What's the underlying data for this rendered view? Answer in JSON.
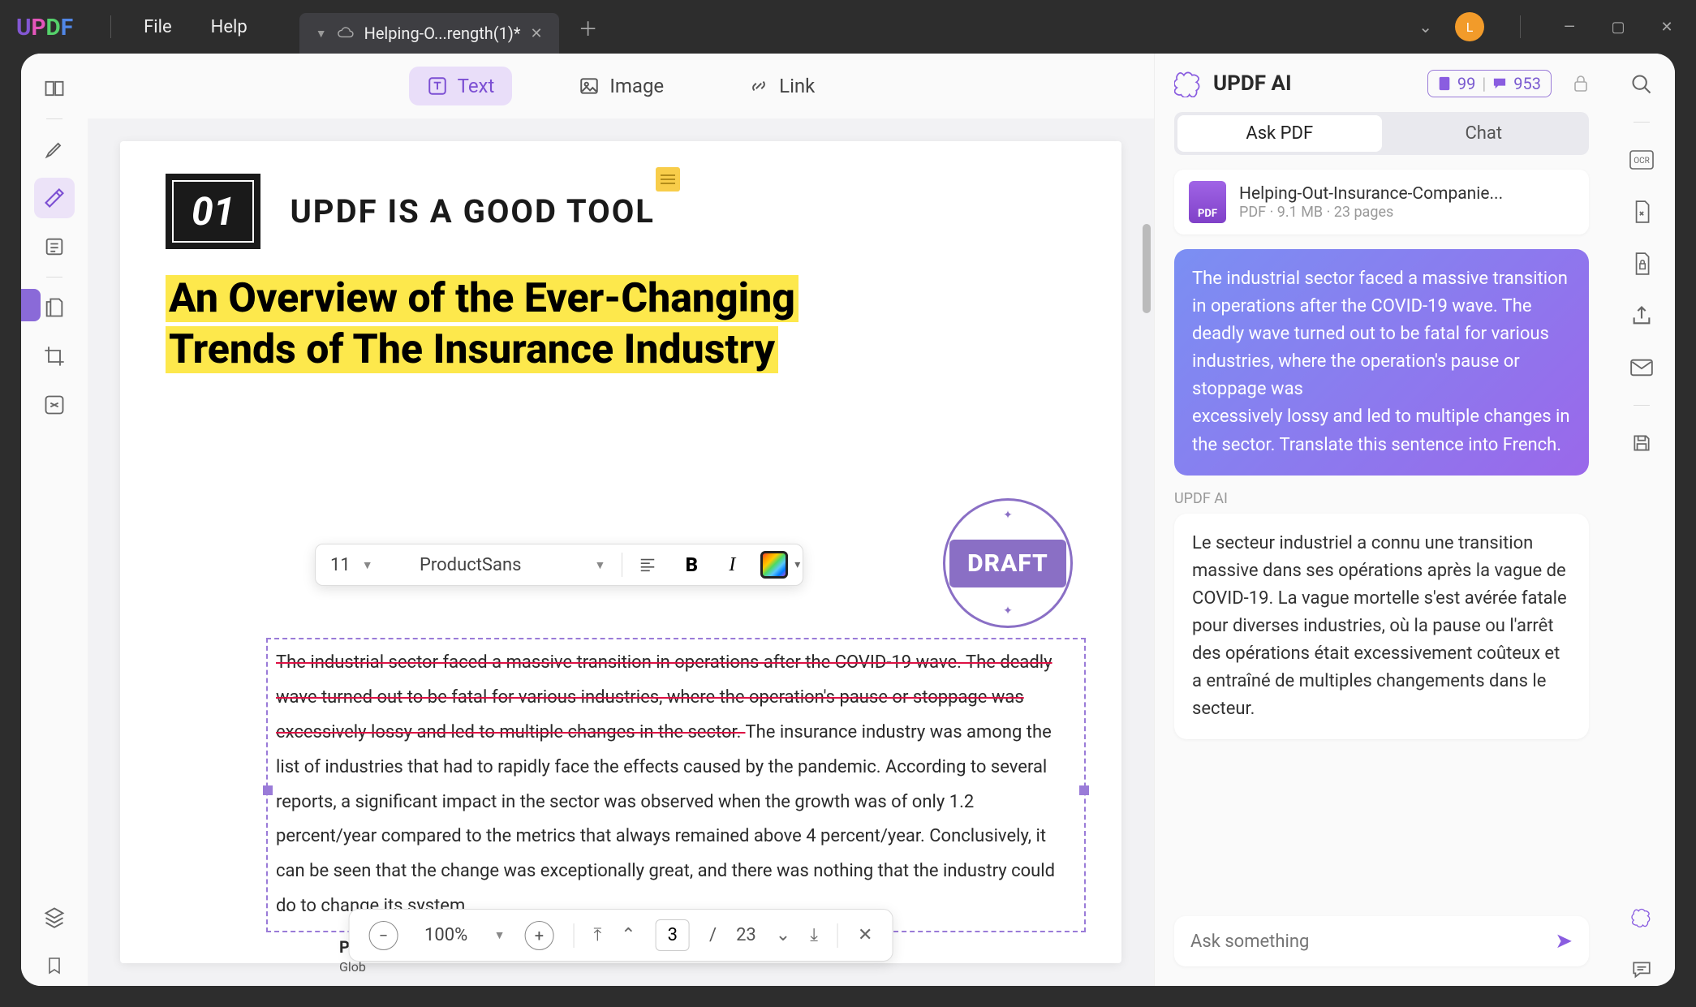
{
  "title_bar": {
    "logo": "UPDF",
    "menus": {
      "file": "File",
      "help": "Help"
    },
    "tab": {
      "title": "Helping-O...rength(1)*",
      "modified": true
    },
    "avatar_initial": "L"
  },
  "top_tools": {
    "text": "Text",
    "image": "Image",
    "link": "Link"
  },
  "document": {
    "section_number": "01",
    "section_title": "UPDF IS A GOOD TOOL",
    "headline_l1": "An Overview of the Ever-Changing",
    "headline_l2": "Trends of The Insurance Industry",
    "stamp": "DRAFT",
    "body_strike": "The industrial sector faced a massive transition in operations after the COVID-19 wave. The deadly wave turned out to be fatal for various industries, where the operation's pause or stoppage was excessively lossy and led to multiple changes in the sector. ",
    "body_rest": "The insurance industry was among the list of industries that had to rapidly face the effects caused by the pandemic. According to several reports, a significant impact in the sector was observed when the growth was of only 1.2 percent/year compared to the metrics that always remained above 4 percent/year. Conclusively, it can be seen that the change was exceptionally great, and there was nothing that the industry could do to change its system.",
    "footer_cut": "Pre",
    "footer_sub": "Glob"
  },
  "text_toolbar": {
    "font_size": "11",
    "font_family": "ProductSans"
  },
  "pager": {
    "zoom": "100%",
    "page": "3",
    "sep": "/",
    "total": "23"
  },
  "ai": {
    "title": "UPDF AI",
    "badge_a": "99",
    "badge_b": "953",
    "tabs": {
      "ask": "Ask PDF",
      "chat": "Chat"
    },
    "file": {
      "name": "Helping-Out-Insurance-Companie...",
      "meta": "PDF · 9.1 MB · 23 pages",
      "icon_label": "PDF"
    },
    "user_msg": "The industrial sector faced a massive transition in operations after the COVID-19 wave. The deadly wave turned out to be fatal for various industries, where the operation's pause or stoppage was\nexcessively lossy and led to multiple changes in the sector.  Translate this sentence into French.",
    "label": "UPDF AI",
    "ai_msg": "Le secteur industriel a connu une transition massive dans ses opérations après la vague de COVID-19. La vague mortelle s'est avérée fatale pour diverses industries, où la pause ou l'arrêt des opérations était excessivement coûteux et a entraîné de multiples changements dans le secteur.",
    "input_placeholder": "Ask something"
  }
}
